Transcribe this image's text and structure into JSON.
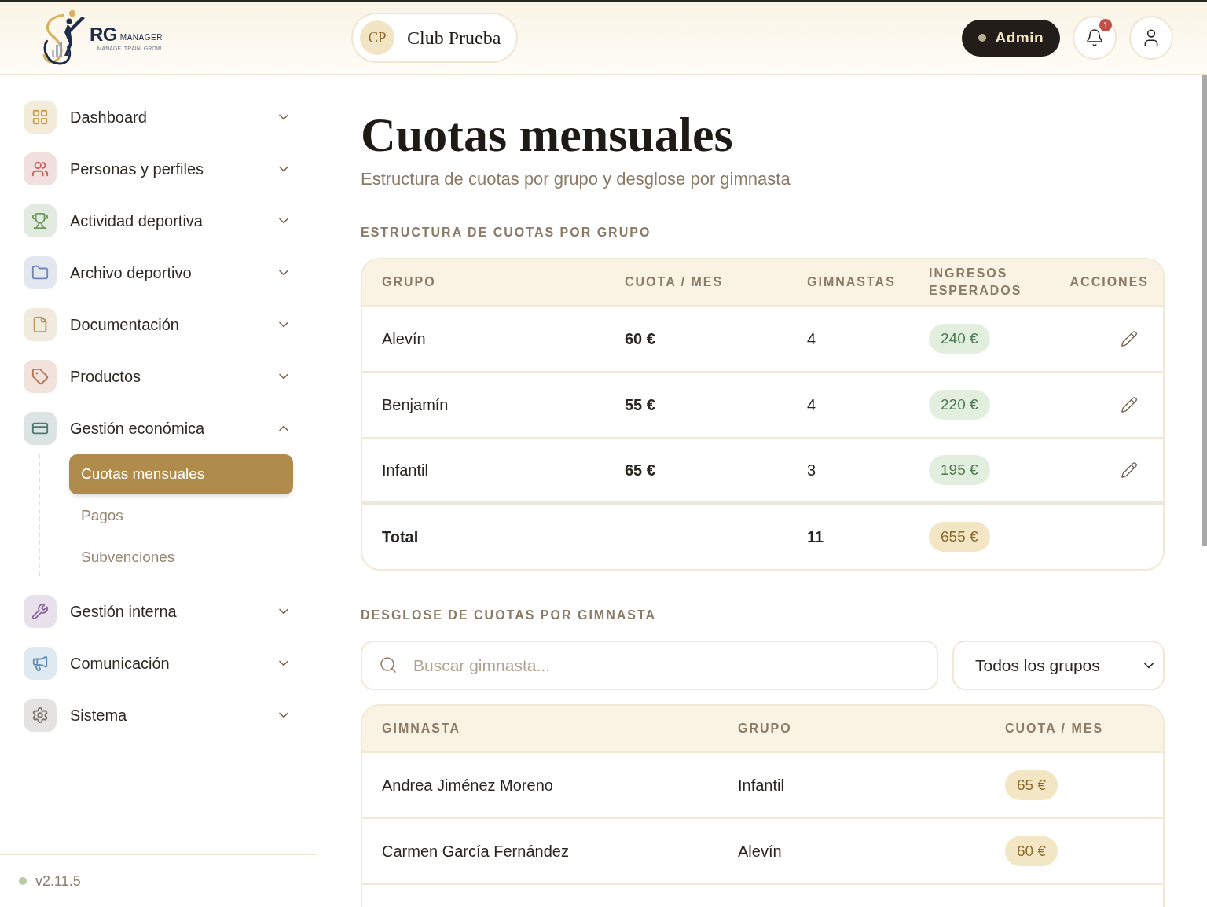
{
  "logo": {
    "mark": "RG",
    "word": "MANAGER",
    "tagline": "MANAGE. TRAIN. GROW."
  },
  "club": {
    "initials": "CP",
    "name": "Club Prueba"
  },
  "role_badge": "Admin",
  "notifications": {
    "count": "1"
  },
  "sidebar": {
    "items": [
      {
        "label": "Dashboard",
        "color": "#c9a14a",
        "expanded": false
      },
      {
        "label": "Personas y perfiles",
        "color": "#c0665e",
        "expanded": false
      },
      {
        "label": "Actividad deportiva",
        "color": "#6e9a62",
        "expanded": false
      },
      {
        "label": "Archivo deportivo",
        "color": "#7088b4",
        "expanded": false
      },
      {
        "label": "Documentación",
        "color": "#b8965a",
        "expanded": false
      },
      {
        "label": "Productos",
        "color": "#b8734e",
        "expanded": false
      },
      {
        "label": "Gestión económica",
        "color": "#4f7a72",
        "expanded": true,
        "children": [
          {
            "label": "Cuotas mensuales",
            "selected": true
          },
          {
            "label": "Pagos",
            "selected": false
          },
          {
            "label": "Subvenciones",
            "selected": false
          }
        ]
      },
      {
        "label": "Gestión interna",
        "color": "#8a6a9e",
        "expanded": false
      },
      {
        "label": "Comunicación",
        "color": "#5f8fb8",
        "expanded": false
      },
      {
        "label": "Sistema",
        "color": "#7a7468",
        "expanded": false
      }
    ],
    "version": "v2.11.5"
  },
  "page": {
    "title": "Cuotas mensuales",
    "subtitle": "Estructura de cuotas por grupo y desglose por gimnasta"
  },
  "group_section": {
    "heading": "ESTRUCTURA DE CUOTAS POR GRUPO",
    "columns": [
      "GRUPO",
      "CUOTA / MES",
      "GIMNASTAS",
      "INGRESOS ESPERADOS",
      "ACCIONES"
    ],
    "rows": [
      {
        "group": "Alevín",
        "fee": "60 €",
        "gymnasts": "4",
        "income": "240 €"
      },
      {
        "group": "Benjamín",
        "fee": "55 €",
        "gymnasts": "4",
        "income": "220 €"
      },
      {
        "group": "Infantil",
        "fee": "65 €",
        "gymnasts": "3",
        "income": "195 €"
      }
    ],
    "total": {
      "label": "Total",
      "gymnasts": "11",
      "income": "655 €"
    }
  },
  "gymnast_section": {
    "heading": "DESGLOSE DE CUOTAS POR GIMNASTA",
    "search": {
      "placeholder": "Buscar gimnasta..."
    },
    "group_filter": {
      "value": "Todos los grupos"
    },
    "columns": [
      "GIMNASTA",
      "GRUPO",
      "CUOTA / MES"
    ],
    "rows": [
      {
        "name": "Andrea Jiménez Moreno",
        "group": "Infantil",
        "fee": "65 €"
      },
      {
        "name": "Carmen García Fernández",
        "group": "Alevín",
        "fee": "60 €"
      }
    ]
  }
}
